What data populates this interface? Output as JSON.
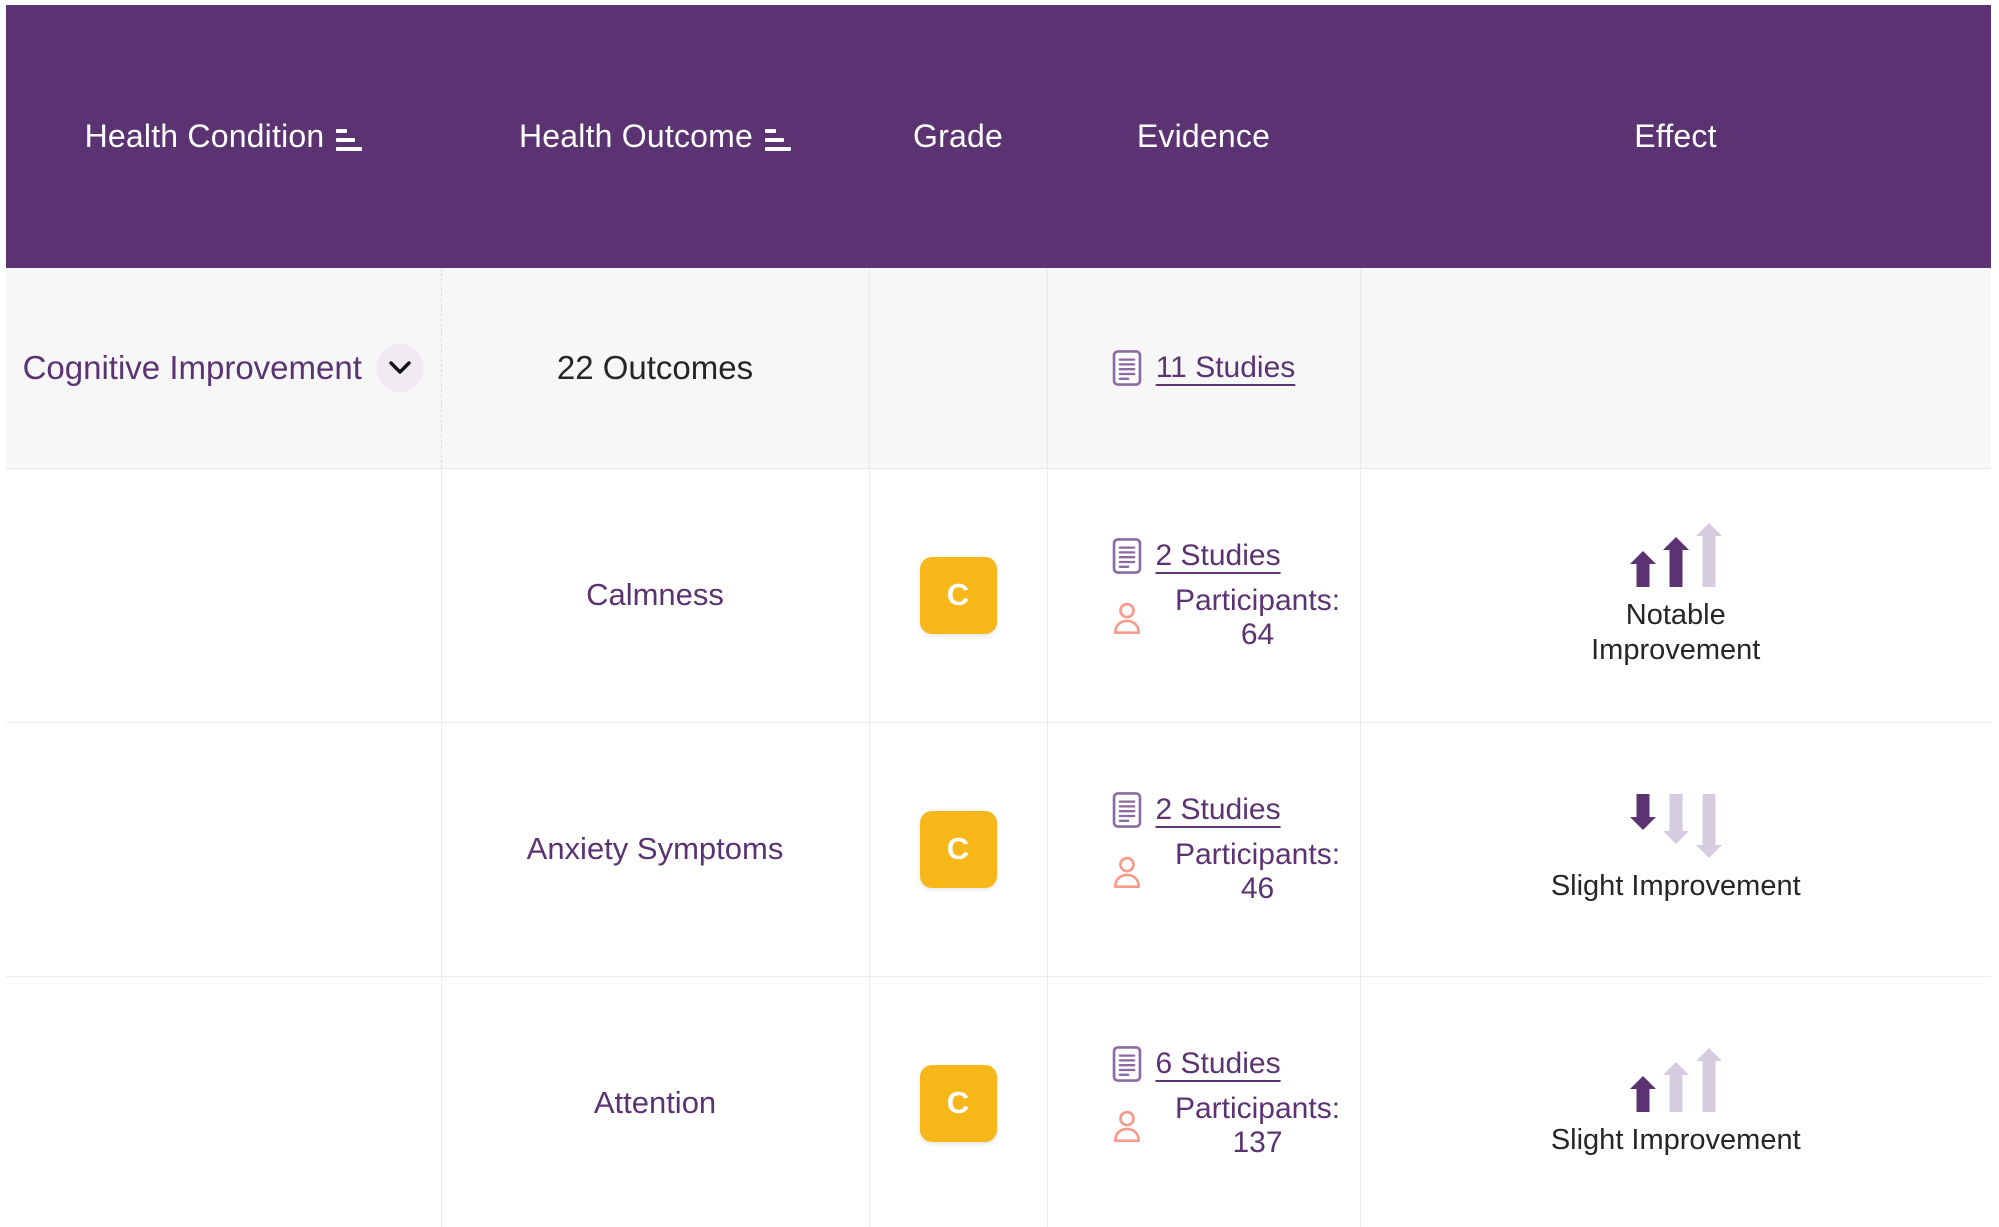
{
  "table": {
    "columns": [
      {
        "label": "Health Condition",
        "sortable": true,
        "name": "health-condition"
      },
      {
        "label": "Health Outcome",
        "sortable": true,
        "name": "health-outcome"
      },
      {
        "label": "Grade",
        "sortable": false,
        "name": "grade"
      },
      {
        "label": "Evidence",
        "sortable": false,
        "name": "evidence"
      },
      {
        "label": "Effect",
        "sortable": false,
        "name": "effect"
      }
    ],
    "group_row": {
      "condition": "Cognitive Improvement",
      "expand_icon": "chevron-down-icon",
      "outcomes_count": "22 Outcomes",
      "grade": "",
      "studies_label": "11 Studies",
      "studies_icon": "document-icon",
      "effect": ""
    },
    "rows": [
      {
        "condition": "",
        "outcome": "Calmness",
        "grade": "C",
        "studies_label": "2 Studies",
        "studies_icon": "document-icon",
        "participants_label": "Participants: 64",
        "participants_icon": "user-icon",
        "effect_label": "Notable Improvement",
        "effect_direction": "up",
        "effect_filled": 2
      },
      {
        "condition": "",
        "outcome": "Anxiety Symptoms",
        "grade": "C",
        "studies_label": "2 Studies",
        "studies_icon": "document-icon",
        "participants_label": "Participants: 46",
        "participants_icon": "user-icon",
        "effect_label": "Slight Improvement",
        "effect_direction": "down",
        "effect_filled": 1
      },
      {
        "condition": "",
        "outcome": "Attention",
        "grade": "C",
        "studies_label": "6 Studies",
        "studies_icon": "document-icon",
        "participants_label": "Participants: 137",
        "participants_icon": "user-icon",
        "effect_label": "Slight Improvement",
        "effect_direction": "up",
        "effect_filled": 1
      }
    ]
  },
  "colors": {
    "header_background": "#5c3372",
    "header_text": "#ffffff",
    "accent_purple": "#5c3372",
    "accent_purple_light": "#d6cce0",
    "grade_c_background": "#f7b719",
    "grade_c_text": "#ffffff",
    "group_row_background": "#f7f7f8",
    "user_icon": "#f79b8d",
    "body_text": "#262626"
  }
}
